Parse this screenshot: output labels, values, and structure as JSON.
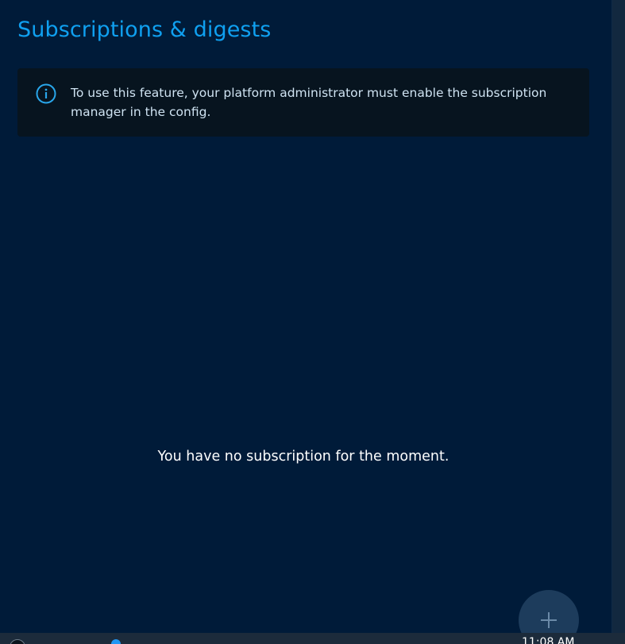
{
  "header": {
    "title": "Subscriptions & digests"
  },
  "alert": {
    "message": "To use this feature, your platform administrator must enable the subscription manager in the config.",
    "icon": "info-icon"
  },
  "empty_state": {
    "message": "You have no subscription for the moment."
  },
  "fab": {
    "icon": "plus-icon"
  },
  "taskbar": {
    "clock": "11:08 AM"
  },
  "colors": {
    "background": "#001b39",
    "title": "#0fa0f0",
    "alert_background": "#07141f",
    "fab_background": "#1d3c5c"
  }
}
